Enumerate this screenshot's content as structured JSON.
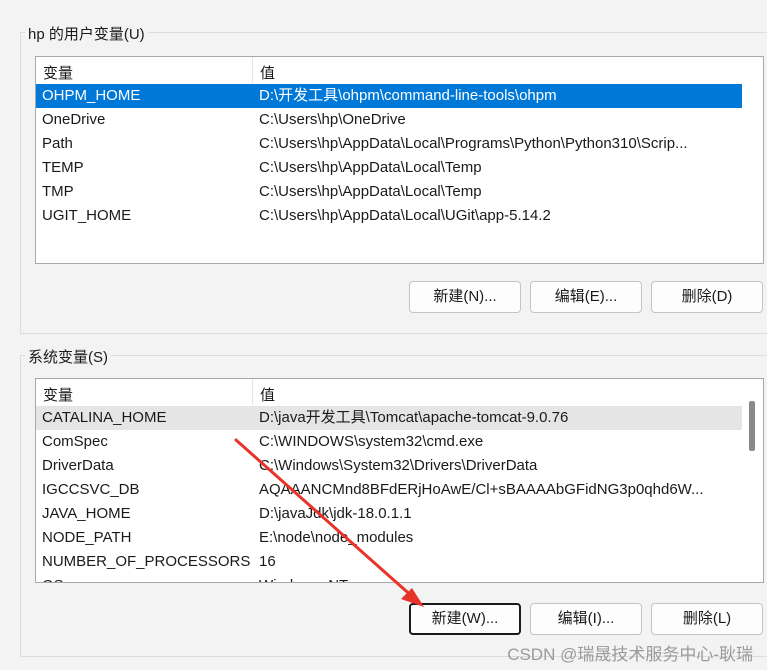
{
  "user_vars": {
    "title": "hp 的用户变量(U)",
    "col_name": "变量",
    "col_value": "值",
    "rows": [
      {
        "name": "OHPM_HOME",
        "value": "D:\\开发工具\\ohpm\\command-line-tools\\ohpm",
        "state": "selected"
      },
      {
        "name": "OneDrive",
        "value": "C:\\Users\\hp\\OneDrive"
      },
      {
        "name": "Path",
        "value": "C:\\Users\\hp\\AppData\\Local\\Programs\\Python\\Python310\\Scrip..."
      },
      {
        "name": "TEMP",
        "value": "C:\\Users\\hp\\AppData\\Local\\Temp"
      },
      {
        "name": "TMP",
        "value": "C:\\Users\\hp\\AppData\\Local\\Temp"
      },
      {
        "name": "UGIT_HOME",
        "value": "C:\\Users\\hp\\AppData\\Local\\UGit\\app-5.14.2"
      }
    ],
    "new_label": "新建(N)...",
    "edit_label": "编辑(E)...",
    "delete_label": "删除(D)"
  },
  "system_vars": {
    "title": "系统变量(S)",
    "col_name": "变量",
    "col_value": "值",
    "rows": [
      {
        "name": "CATALINA_HOME",
        "value": "D:\\java开发工具\\Tomcat\\apache-tomcat-9.0.76",
        "state": "hover"
      },
      {
        "name": "ComSpec",
        "value": "C:\\WINDOWS\\system32\\cmd.exe"
      },
      {
        "name": "DriverData",
        "value": "C:\\Windows\\System32\\Drivers\\DriverData"
      },
      {
        "name": "IGCCSVC_DB",
        "value": "AQAAANCMnd8BFdERjHoAwE/Cl+sBAAAAbGFidNG3p0qhd6W..."
      },
      {
        "name": "JAVA_HOME",
        "value": "D:\\javaJdk\\jdk-18.0.1.1"
      },
      {
        "name": "NODE_PATH",
        "value": "E:\\node\\node_modules"
      },
      {
        "name": "NUMBER_OF_PROCESSORS",
        "value": "16"
      },
      {
        "name": "OS",
        "value": "Windows_NT"
      }
    ],
    "new_label": "新建(W)...",
    "edit_label": "编辑(I)...",
    "delete_label": "删除(L)"
  },
  "watermark": "CSDN @瑞晟技术服务中心-耿瑞",
  "colors": {
    "selection": "#0078d7",
    "annotation_arrow": "#e8332a"
  }
}
